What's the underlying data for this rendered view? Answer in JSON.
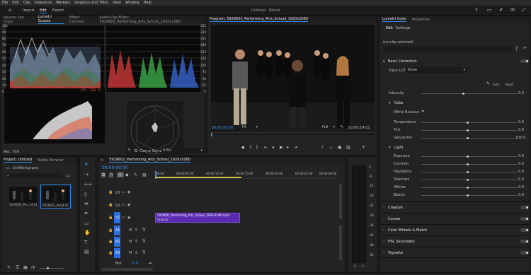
{
  "menu": [
    "File",
    "Edit",
    "Clip",
    "Sequence",
    "Markers",
    "Graphics and Titles",
    "View",
    "Window",
    "Help"
  ],
  "header": {
    "tabs": [
      "Import",
      "Edit",
      "Export"
    ],
    "title": "Untitled - Edited"
  },
  "scopes_panel": {
    "tabs": [
      "Source: (no clips)",
      "Lumetri Scopes",
      "Effect Controls",
      "Audio Clip Mixer: 5929602_Performing_Arts_School_1920x1080"
    ],
    "left_scale": [
      "100",
      "90",
      "80",
      "70",
      "60",
      "50",
      "40",
      "30",
      "20",
      "10",
      "0"
    ],
    "right_scale": [
      "255",
      "230",
      "205",
      "180",
      "155",
      "128",
      "100",
      "75",
      "50",
      "25",
      "0"
    ],
    "hist_labels": [
      "255",
      "128",
      "0"
    ],
    "bottom_label": "Rec. 709",
    "clamp_label": "Clamp Signal",
    "bit_depth": "8 Bit"
  },
  "program": {
    "title": "Program: 5929602_Performing_Arts_School_1920x1080",
    "timecode": "00:00:00:00",
    "fit": "Fit",
    "quality": "Full",
    "duration": "00:00:14:01"
  },
  "lumetri": {
    "tabs": [
      "Lumetri Color",
      "Properties"
    ],
    "subtabs": [
      "Edit",
      "Settings"
    ],
    "clip": "(no clip selected)",
    "basic": "Basic Correction",
    "input_lut": "Input LUT",
    "lut_value": "None",
    "auto": "Auto",
    "reset": "Reset",
    "intensity": "Intensity",
    "intensity_value": "0.0",
    "color_section": "Color",
    "white_balance": "White Balance",
    "color_sliders": [
      {
        "label": "Temperature",
        "value": "0.0"
      },
      {
        "label": "Tint",
        "value": "0.0"
      },
      {
        "label": "Saturation",
        "value": "100.0"
      }
    ],
    "light_section": "Light",
    "light_sliders": [
      {
        "label": "Exposure",
        "value": "0.0"
      },
      {
        "label": "Contrast",
        "value": "0.0"
      },
      {
        "label": "Highlights",
        "value": "0.0"
      },
      {
        "label": "Shadows",
        "value": "0.0"
      },
      {
        "label": "Whites",
        "value": "0.0"
      },
      {
        "label": "Blacks",
        "value": "0.0"
      }
    ],
    "sections": [
      "Creative",
      "Curves",
      "Color Wheels & Match",
      "HSL Secondary",
      "Vignette"
    ]
  },
  "project": {
    "tabs": [
      "Project: Untitled",
      "Media Browser"
    ],
    "file": "Untitled.prproj",
    "thumbs": [
      {
        "name": "5929602_Per...",
        "dur": "14:01"
      },
      {
        "name": "5929602_Per...",
        "dur": "14:01"
      }
    ]
  },
  "timeline": {
    "tab": "5929602_Performing_Arts_School_1920x1080",
    "timecode": "00:00:00:00",
    "ruler": [
      ":00:00",
      "00:00:05:00",
      "00:00:10:00",
      "00:00:15:00",
      "00:00:20:00",
      "00:00:25:00",
      "00:00:30:00"
    ],
    "video_tracks": [
      "V3",
      "V2",
      "V1"
    ],
    "audio_tracks": [
      "A1",
      "A2",
      "A3"
    ],
    "mix": "Mix",
    "mix_value": "0.0",
    "clip_name": "5929602_Performing_Arts_School_1920x1080.mp4",
    "clip_sub": "Opacity"
  },
  "meter": {
    "scale": [
      "0",
      "-6",
      "-12",
      "-18",
      "-24",
      "-30",
      "-36",
      "-42",
      "-48",
      "-54"
    ],
    "labels": [
      "S",
      "S"
    ]
  }
}
